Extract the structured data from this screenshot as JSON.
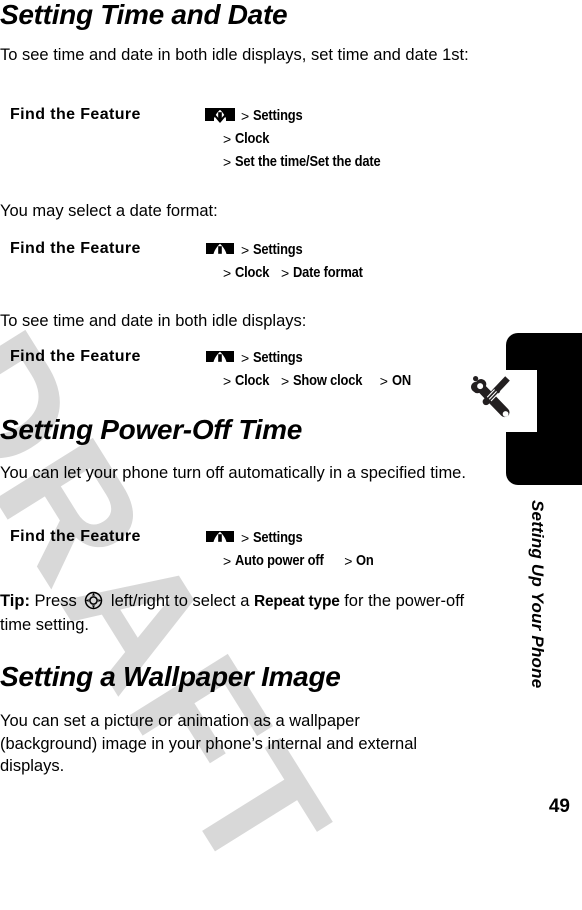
{
  "document": {
    "watermark": "DRAFT",
    "page_number": "49",
    "side_label": "Setting Up Your Phone",
    "side_tab_icon": "wrench-screwdriver-icon"
  },
  "sections": [
    {
      "heading": "Setting Time and Date",
      "intro": "To see time and date in both idle displays, set time and date 1st:",
      "find_the_feature": {
        "label": "Find the Feature",
        "key_icon": "menu-key-icon",
        "lines": [
          {
            "sep": ">",
            "items": [
              "Settings"
            ]
          },
          {
            "sep": ">",
            "items": [
              "Clock"
            ]
          },
          {
            "sep": ">",
            "items": [
              "Set the time/Set the date"
            ]
          }
        ]
      }
    },
    {
      "intro": "You may select a date format:",
      "find_the_feature": {
        "label": "Find the Feature",
        "key_icon": "menu-key-icon",
        "lines": [
          {
            "sep": ">",
            "items": [
              "Settings"
            ]
          },
          {
            "sep": ">",
            "items": [
              "Clock",
              "Date format"
            ]
          }
        ]
      }
    },
    {
      "intro": "To see time and date in both idle displays:",
      "find_the_feature": {
        "label": "Find the Feature",
        "key_icon": "menu-key-icon",
        "lines": [
          {
            "sep": ">",
            "items": [
              "Settings"
            ]
          },
          {
            "sep": ">",
            "items": [
              "Clock",
              "Show clock",
              "ON"
            ]
          }
        ]
      }
    },
    {
      "heading": "Setting Power-Off Time",
      "intro": "You can let your phone turn off automatically in a specified time.",
      "find_the_feature": {
        "label": "Find the Feature",
        "key_icon": "menu-key-icon",
        "lines": [
          {
            "sep": ">",
            "items": [
              "Settings"
            ]
          },
          {
            "sep": ">",
            "items": [
              "Auto power off",
              "On"
            ]
          }
        ]
      },
      "tip": {
        "prefix": "Tip:",
        "before_icon": " Press ",
        "icon": "navigation-key-icon",
        "after_icon": " left/right to select a ",
        "bold_term": "Repeat type",
        "tail": " for the power-off time setting."
      }
    },
    {
      "heading": "Setting a Wallpaper Image",
      "intro": "You can set a picture or animation as a wallpaper (background) image in your phone’s internal and external displays."
    }
  ],
  "separators": {
    "gt": ">"
  }
}
